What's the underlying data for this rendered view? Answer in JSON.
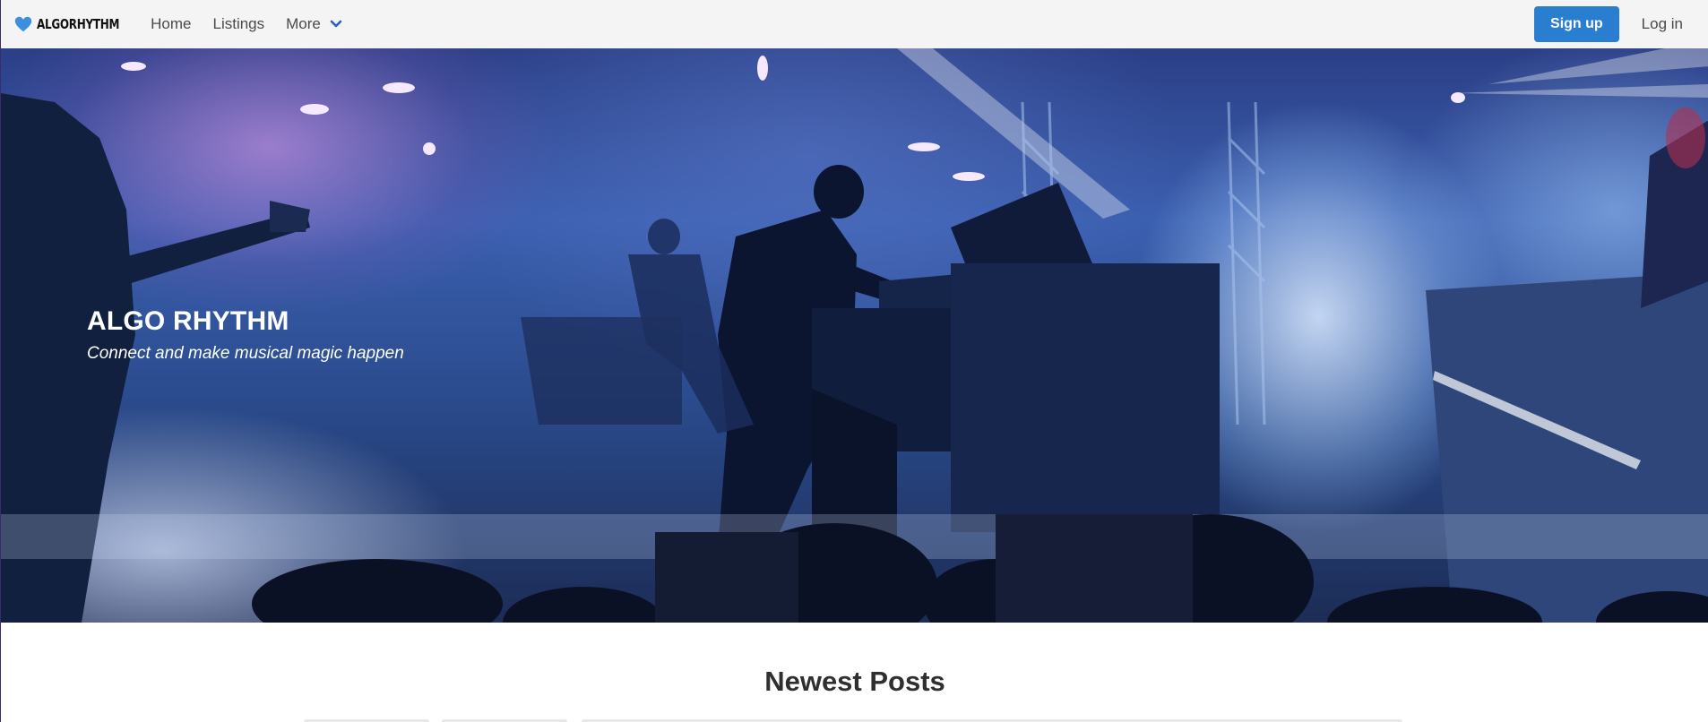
{
  "navbar": {
    "brand": "ALGORHYTHM",
    "links": [
      "Home",
      "Listings",
      "More"
    ],
    "signup_label": "Sign up",
    "login_label": "Log in"
  },
  "hero": {
    "title": "ALGO RHYTHM",
    "subtitle": "Connect and make musical magic happen"
  },
  "section": {
    "title": "Newest Posts"
  },
  "colors": {
    "brand_blue": "#2a7ed0",
    "navbar_bg": "#f4f4f4",
    "heart": "#3a8fe0"
  },
  "icons": {
    "logo": "heart-icon",
    "more": "chevron-down-icon"
  }
}
